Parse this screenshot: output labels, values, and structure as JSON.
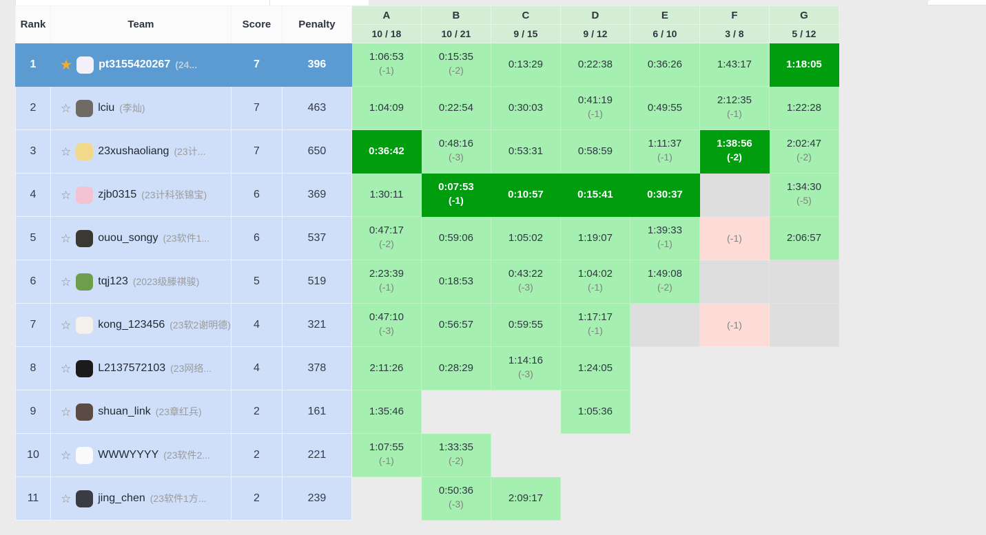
{
  "board": {
    "fixed_headers": [
      "Rank",
      "Team",
      "Score",
      "Penalty"
    ],
    "problems": [
      {
        "letter": "A",
        "stat": "10 / 18"
      },
      {
        "letter": "B",
        "stat": "10 / 21"
      },
      {
        "letter": "C",
        "stat": "9 / 15"
      },
      {
        "letter": "D",
        "stat": "9 / 12"
      },
      {
        "letter": "E",
        "stat": "6 / 10"
      },
      {
        "letter": "F",
        "stat": "3 / 8"
      },
      {
        "letter": "G",
        "stat": "5 / 12"
      }
    ],
    "rows": [
      {
        "rank": "1",
        "starred": true,
        "star": "★",
        "name": "pt3155420267",
        "affiliation": "(24...",
        "avatar_color": "#f3f0fb",
        "score": "7",
        "penalty": "396",
        "leader": true,
        "cells": [
          {
            "state": "solved",
            "time": "1:06:53",
            "tries": "(-1)"
          },
          {
            "state": "solved",
            "time": "0:15:35",
            "tries": "(-2)"
          },
          {
            "state": "solved",
            "time": "0:13:29",
            "tries": ""
          },
          {
            "state": "solved",
            "time": "0:22:38",
            "tries": ""
          },
          {
            "state": "solved",
            "time": "0:36:26",
            "tries": ""
          },
          {
            "state": "solved",
            "time": "1:43:17",
            "tries": ""
          },
          {
            "state": "first",
            "time": "1:18:05",
            "tries": ""
          }
        ]
      },
      {
        "rank": "2",
        "starred": false,
        "star": "☆",
        "name": "lciu",
        "affiliation": "(李灿)",
        "avatar_color": "#6f6a63",
        "score": "7",
        "penalty": "463",
        "leader": false,
        "cells": [
          {
            "state": "solved",
            "time": "1:04:09",
            "tries": ""
          },
          {
            "state": "solved",
            "time": "0:22:54",
            "tries": ""
          },
          {
            "state": "solved",
            "time": "0:30:03",
            "tries": ""
          },
          {
            "state": "solved",
            "time": "0:41:19",
            "tries": "(-1)"
          },
          {
            "state": "solved",
            "time": "0:49:55",
            "tries": ""
          },
          {
            "state": "solved",
            "time": "2:12:35",
            "tries": "(-1)"
          },
          {
            "state": "solved",
            "time": "1:22:28",
            "tries": ""
          }
        ]
      },
      {
        "rank": "3",
        "starred": false,
        "star": "☆",
        "name": "23xushaoliang",
        "affiliation": "(23计...",
        "avatar_color": "#f2d98a",
        "score": "7",
        "penalty": "650",
        "leader": false,
        "cells": [
          {
            "state": "first",
            "time": "0:36:42",
            "tries": ""
          },
          {
            "state": "solved",
            "time": "0:48:16",
            "tries": "(-3)"
          },
          {
            "state": "solved",
            "time": "0:53:31",
            "tries": ""
          },
          {
            "state": "solved",
            "time": "0:58:59",
            "tries": ""
          },
          {
            "state": "solved",
            "time": "1:11:37",
            "tries": "(-1)"
          },
          {
            "state": "first",
            "time": "1:38:56",
            "tries": "(-2)"
          },
          {
            "state": "solved",
            "time": "2:02:47",
            "tries": "(-2)"
          }
        ]
      },
      {
        "rank": "4",
        "starred": false,
        "star": "☆",
        "name": "zjb0315",
        "affiliation": "(23计科张锦宝)",
        "avatar_color": "#f3c3d2",
        "score": "6",
        "penalty": "369",
        "leader": false,
        "cells": [
          {
            "state": "solved",
            "time": "1:30:11",
            "tries": ""
          },
          {
            "state": "first",
            "time": "0:07:53",
            "tries": "(-1)"
          },
          {
            "state": "first",
            "time": "0:10:57",
            "tries": ""
          },
          {
            "state": "first",
            "time": "0:15:41",
            "tries": ""
          },
          {
            "state": "first",
            "time": "0:30:37",
            "tries": ""
          },
          {
            "state": "pending",
            "time": "",
            "tries": ""
          },
          {
            "state": "solved",
            "time": "1:34:30",
            "tries": "(-5)"
          }
        ]
      },
      {
        "rank": "5",
        "starred": false,
        "star": "☆",
        "name": "ouou_songy",
        "affiliation": "(23软件1...",
        "avatar_color": "#3a3832",
        "score": "6",
        "penalty": "537",
        "leader": false,
        "cells": [
          {
            "state": "solved",
            "time": "0:47:17",
            "tries": "(-2)"
          },
          {
            "state": "solved",
            "time": "0:59:06",
            "tries": ""
          },
          {
            "state": "solved",
            "time": "1:05:02",
            "tries": ""
          },
          {
            "state": "solved",
            "time": "1:19:07",
            "tries": ""
          },
          {
            "state": "solved",
            "time": "1:39:33",
            "tries": "(-1)"
          },
          {
            "state": "failed",
            "time": "",
            "tries": "(-1)"
          },
          {
            "state": "solved",
            "time": "2:06:57",
            "tries": ""
          }
        ]
      },
      {
        "rank": "6",
        "starred": false,
        "star": "☆",
        "name": "tqj123",
        "affiliation": "(2023级滕祺骏)",
        "avatar_color": "#6f9e4a",
        "score": "5",
        "penalty": "519",
        "leader": false,
        "cells": [
          {
            "state": "solved",
            "time": "2:23:39",
            "tries": "(-1)"
          },
          {
            "state": "solved",
            "time": "0:18:53",
            "tries": ""
          },
          {
            "state": "solved",
            "time": "0:43:22",
            "tries": "(-3)"
          },
          {
            "state": "solved",
            "time": "1:04:02",
            "tries": "(-1)"
          },
          {
            "state": "solved",
            "time": "1:49:08",
            "tries": "(-2)"
          },
          {
            "state": "pending",
            "time": "",
            "tries": ""
          },
          {
            "state": "pending",
            "time": "",
            "tries": ""
          }
        ]
      },
      {
        "rank": "7",
        "starred": false,
        "star": "☆",
        "name": "kong_123456",
        "affiliation": "(23软2谢明德)",
        "avatar_color": "#f4f1ec",
        "score": "4",
        "penalty": "321",
        "leader": false,
        "cells": [
          {
            "state": "solved",
            "time": "0:47:10",
            "tries": "(-3)"
          },
          {
            "state": "solved",
            "time": "0:56:57",
            "tries": ""
          },
          {
            "state": "solved",
            "time": "0:59:55",
            "tries": ""
          },
          {
            "state": "solved",
            "time": "1:17:17",
            "tries": "(-1)"
          },
          {
            "state": "pending",
            "time": "",
            "tries": ""
          },
          {
            "state": "failed",
            "time": "",
            "tries": "(-1)"
          },
          {
            "state": "pending",
            "time": "",
            "tries": ""
          }
        ]
      },
      {
        "rank": "8",
        "starred": false,
        "star": "☆",
        "name": "L2137572103",
        "affiliation": "(23网络...",
        "avatar_color": "#1b1b1b",
        "score": "4",
        "penalty": "378",
        "leader": false,
        "cells": [
          {
            "state": "solved",
            "time": "2:11:26",
            "tries": ""
          },
          {
            "state": "solved",
            "time": "0:28:29",
            "tries": ""
          },
          {
            "state": "solved",
            "time": "1:14:16",
            "tries": "(-3)"
          },
          {
            "state": "solved",
            "time": "1:24:05",
            "tries": ""
          },
          {
            "state": "none",
            "time": "",
            "tries": ""
          },
          {
            "state": "none",
            "time": "",
            "tries": ""
          },
          {
            "state": "none",
            "time": "",
            "tries": ""
          }
        ]
      },
      {
        "rank": "9",
        "starred": false,
        "star": "☆",
        "name": "shuan_link",
        "affiliation": "(23章红兵)",
        "avatar_color": "#5a4c44",
        "score": "2",
        "penalty": "161",
        "leader": false,
        "cells": [
          {
            "state": "solved",
            "time": "1:35:46",
            "tries": ""
          },
          {
            "state": "none",
            "time": "",
            "tries": ""
          },
          {
            "state": "none",
            "time": "",
            "tries": ""
          },
          {
            "state": "solved",
            "time": "1:05:36",
            "tries": ""
          },
          {
            "state": "none",
            "time": "",
            "tries": ""
          },
          {
            "state": "none",
            "time": "",
            "tries": ""
          },
          {
            "state": "none",
            "time": "",
            "tries": ""
          }
        ]
      },
      {
        "rank": "10",
        "starred": false,
        "star": "☆",
        "name": "WWWYYYY",
        "affiliation": "(23软件2...",
        "avatar_color": "#fafafa",
        "score": "2",
        "penalty": "221",
        "leader": false,
        "cells": [
          {
            "state": "solved",
            "time": "1:07:55",
            "tries": "(-1)"
          },
          {
            "state": "solved",
            "time": "1:33:35",
            "tries": "(-2)"
          },
          {
            "state": "none",
            "time": "",
            "tries": ""
          },
          {
            "state": "none",
            "time": "",
            "tries": ""
          },
          {
            "state": "none",
            "time": "",
            "tries": ""
          },
          {
            "state": "none",
            "time": "",
            "tries": ""
          },
          {
            "state": "none",
            "time": "",
            "tries": ""
          }
        ]
      },
      {
        "rank": "11",
        "starred": false,
        "star": "☆",
        "name": "jing_chen",
        "affiliation": "(23软件1方...",
        "avatar_color": "#3b3b42",
        "score": "2",
        "penalty": "239",
        "leader": false,
        "cells": [
          {
            "state": "none",
            "time": "",
            "tries": ""
          },
          {
            "state": "solved",
            "time": "0:50:36",
            "tries": "(-3)"
          },
          {
            "state": "solved",
            "time": "2:09:17",
            "tries": ""
          },
          {
            "state": "none",
            "time": "",
            "tries": ""
          },
          {
            "state": "none",
            "time": "",
            "tries": ""
          },
          {
            "state": "none",
            "time": "",
            "tries": ""
          },
          {
            "state": "none",
            "time": "",
            "tries": ""
          }
        ]
      }
    ]
  },
  "colors": {
    "solved": "#a5efb0",
    "first_solve": "#009e0f",
    "failed": "#fddcd7",
    "pending": "#dedede",
    "leader_row": "#5b9bd1",
    "team_row": "#cfdffa",
    "problem_header": "#d4eed6",
    "page_background": "#ebebeb"
  }
}
